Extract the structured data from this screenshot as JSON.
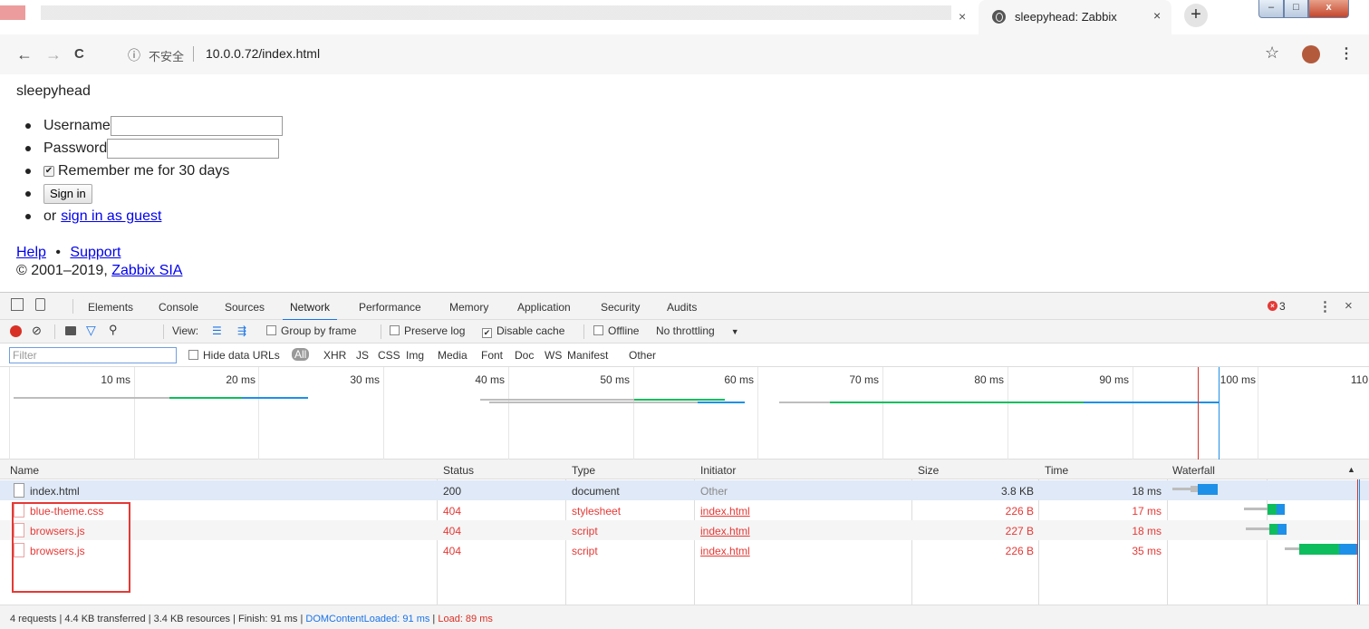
{
  "browser": {
    "tab_title": "sleepyhead: Zabbix",
    "tab_close": "×",
    "prev_tab_close": "×",
    "new_tab": "+",
    "window_buttons": {
      "minimize": "–",
      "maximize": "□",
      "close": "x"
    }
  },
  "address_bar": {
    "back": "←",
    "forward": "→",
    "reload": "C",
    "info_icon": "ⓘ",
    "security_label": "不安全",
    "url": "10.0.0.72/index.html",
    "bookmark": "☆",
    "menu": "⋮"
  },
  "page": {
    "site_title": "sleepyhead",
    "username_label": "Username",
    "password_label": "Password",
    "remember_label": "Remember me for 30 days",
    "remember_checked": true,
    "sign_in": "Sign in",
    "or_text": "or",
    "guest_link": "sign in as guest",
    "help_link": "Help",
    "footer_dot": "•",
    "support_link": "Support",
    "copyright": "© 2001–2019,",
    "company_link": "Zabbix SIA"
  },
  "devtools": {
    "tabs": [
      "Elements",
      "Console",
      "Sources",
      "Network",
      "Performance",
      "Memory",
      "Application",
      "Security",
      "Audits"
    ],
    "active_tab": "Network",
    "error_count": "3",
    "toolbar": {
      "view_label": "View:",
      "group_by_frame": "Group by frame",
      "preserve_log": "Preserve log",
      "disable_cache": "Disable cache",
      "offline": "Offline",
      "throttling": "No throttling"
    },
    "filter": {
      "placeholder": "Filter",
      "hide_data_urls": "Hide data URLs",
      "types": [
        "All",
        "XHR",
        "JS",
        "CSS",
        "Img",
        "Media",
        "Font",
        "Doc",
        "WS",
        "Manifest",
        "Other"
      ]
    },
    "timeline_ticks": [
      "10 ms",
      "20 ms",
      "30 ms",
      "40 ms",
      "50 ms",
      "60 ms",
      "70 ms",
      "80 ms",
      "90 ms",
      "100 ms",
      "110"
    ],
    "columns": [
      "Name",
      "Status",
      "Type",
      "Initiator",
      "Size",
      "Time",
      "Waterfall"
    ],
    "requests": [
      {
        "name": "index.html",
        "status": "200",
        "type": "document",
        "initiator": "Other",
        "size": "3.8 KB",
        "time": "18 ms",
        "error": false
      },
      {
        "name": "blue-theme.css",
        "status": "404",
        "type": "stylesheet",
        "initiator": "index.html",
        "size": "226 B",
        "time": "17 ms",
        "error": true
      },
      {
        "name": "browsers.js",
        "status": "404",
        "type": "script",
        "initiator": "index.html",
        "size": "227 B",
        "time": "18 ms",
        "error": true
      },
      {
        "name": "browsers.js",
        "status": "404",
        "type": "script",
        "initiator": "index.html",
        "size": "226 B",
        "time": "35 ms",
        "error": true
      }
    ],
    "summary": {
      "requests": "4 requests",
      "transferred": "4.4 KB transferred",
      "resources": "3.4 KB resources",
      "finish": "Finish: 91 ms",
      "dom_content_loaded": "DOMContentLoaded: 91 ms",
      "load": "Load: 89 ms",
      "separator": "|"
    },
    "colors": {
      "accent": "#1a73e8",
      "error": "#e53935",
      "waiting": "#0ebd5d",
      "download": "#1e90e8"
    }
  }
}
